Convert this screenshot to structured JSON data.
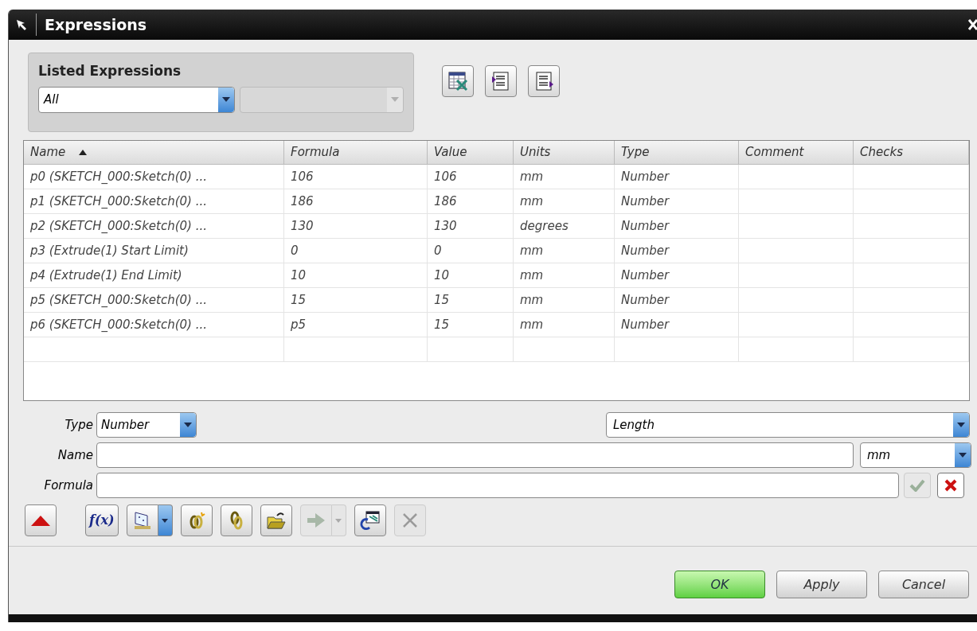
{
  "window": {
    "title": "Expressions"
  },
  "listed_expressions": {
    "title": "Listed Expressions",
    "filter": {
      "value": "All"
    },
    "secondary_filter": {
      "disabled": true
    }
  },
  "top_toolbar": [
    {
      "kind": "spreadsheet"
    },
    {
      "kind": "import"
    },
    {
      "kind": "export"
    }
  ],
  "table": {
    "columns": [
      {
        "label": "Name",
        "sorted": true
      },
      {
        "label": "Formula",
        "sorted": false
      },
      {
        "label": "Value",
        "sorted": false
      },
      {
        "label": "Units",
        "sorted": false
      },
      {
        "label": "Type",
        "sorted": false
      },
      {
        "label": "Comment",
        "sorted": false
      },
      {
        "label": "Checks",
        "sorted": false
      }
    ],
    "rows": [
      {
        "name": "p0  (SKETCH_000:Sketch(0) ...",
        "formula": "106",
        "value": "106",
        "units": "mm",
        "type": "Number"
      },
      {
        "name": "p1  (SKETCH_000:Sketch(0) ...",
        "formula": "186",
        "value": "186",
        "units": "mm",
        "type": "Number"
      },
      {
        "name": "p2  (SKETCH_000:Sketch(0) ...",
        "formula": "130",
        "value": "130",
        "units": "degrees",
        "type": "Number"
      },
      {
        "name": "p3  (Extrude(1) Start Limit)",
        "formula": "0",
        "value": "0",
        "units": "mm",
        "type": "Number"
      },
      {
        "name": "p4  (Extrude(1) End Limit)",
        "formula": "10",
        "value": "10",
        "units": "mm",
        "type": "Number"
      },
      {
        "name": "p5  (SKETCH_000:Sketch(0) ...",
        "formula": "15",
        "value": "15",
        "units": "mm",
        "type": "Number"
      },
      {
        "name": "p6  (SKETCH_000:Sketch(0) ...",
        "formula": "p5",
        "value": "15",
        "units": "mm",
        "type": "Number"
      }
    ]
  },
  "form": {
    "type_label": "Type",
    "type_value": "Number",
    "dimension_value": "Length",
    "name_label": "Name",
    "unit_value": "mm",
    "formula_label": "Formula",
    "accept": {
      "disabled": true
    },
    "reject": {
      "disabled": false
    }
  },
  "bottom_toolbar": [
    {
      "kind": "collapse",
      "disabled": false
    },
    {
      "kind": "function",
      "label": "f(x)",
      "disabled": false
    },
    {
      "kind": "measure",
      "disabled": false
    },
    {
      "kind": "link-new",
      "disabled": false
    },
    {
      "kind": "link-edit",
      "disabled": false
    },
    {
      "kind": "open-folder",
      "disabled": false
    },
    {
      "kind": "arrow",
      "disabled": true
    },
    {
      "kind": "refresh",
      "disabled": false
    },
    {
      "kind": "delete",
      "disabled": true
    }
  ],
  "buttons": [
    {
      "label": "OK",
      "default": true
    },
    {
      "label": "Apply",
      "default": false
    },
    {
      "label": "Cancel",
      "default": false
    }
  ]
}
